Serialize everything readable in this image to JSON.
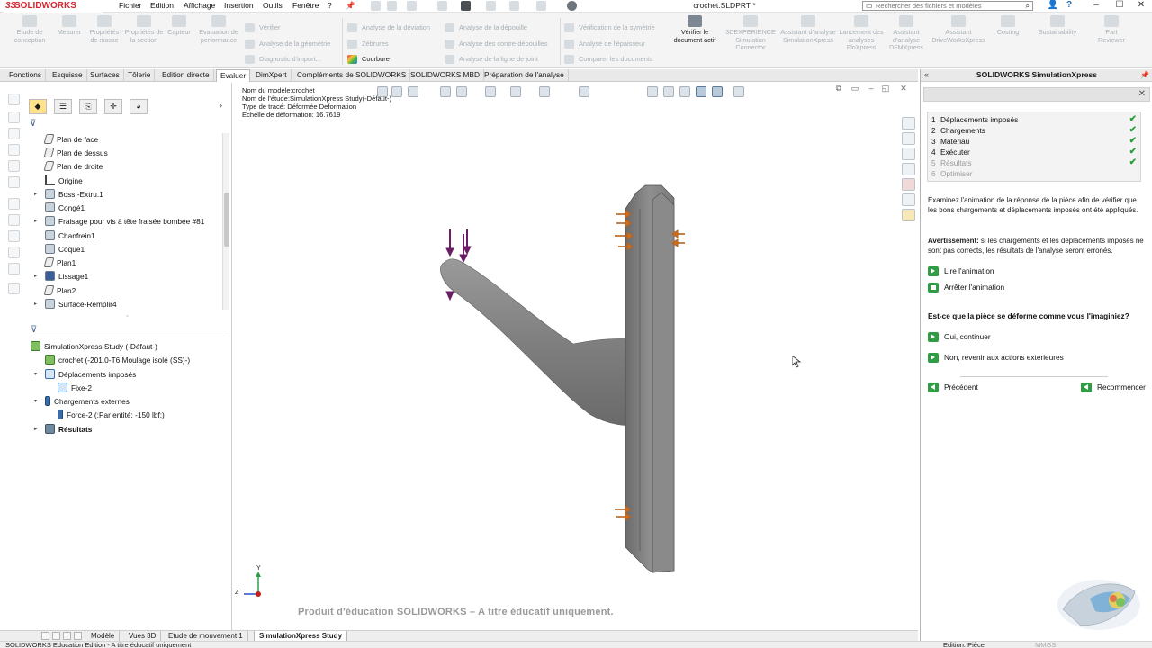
{
  "app": {
    "logo": "SOLIDWORKS",
    "logo_prefix": "3S",
    "menu": [
      "Fichier",
      "Edition",
      "Affichage",
      "Insertion",
      "Outils",
      "Fenêtre",
      "?"
    ],
    "document_title": "crochet.SLDPRT *",
    "search_placeholder": "Rechercher des fichiers et modèles",
    "help_icon_label": "?"
  },
  "ribbon": {
    "big_buttons": [
      {
        "label": "Etude de conception",
        "icon": "design-study-icon"
      },
      {
        "label": "Mesurer",
        "icon": "measure-icon"
      },
      {
        "label": "Propriétés de masse",
        "icon": "mass-properties-icon"
      },
      {
        "label": "Propriétés de la section",
        "icon": "section-properties-icon"
      },
      {
        "label": "Capteur",
        "icon": "sensor-icon"
      },
      {
        "label": "Evaluation de performance",
        "icon": "performance-icon"
      }
    ],
    "group1": [
      {
        "label": "Vérifier",
        "active": false
      },
      {
        "label": "Analyse de la géométrie",
        "active": false
      },
      {
        "label": "Diagnostic d'import...",
        "active": false
      }
    ],
    "group2": [
      {
        "label": "Analyse de la déviation",
        "active": false
      },
      {
        "label": "Zébrures",
        "active": false
      },
      {
        "label": "Courbure",
        "active": true
      }
    ],
    "group3": [
      {
        "label": "Analyse de la dépouille",
        "active": false
      },
      {
        "label": "Analyse des contre-dépouilles",
        "active": false
      },
      {
        "label": "Analyse de la ligne de joint",
        "active": false
      }
    ],
    "group4": [
      {
        "label": "Vérification de la symétrie",
        "active": false
      },
      {
        "label": "Analyse de l'épaisseur",
        "active": false
      },
      {
        "label": "Comparer les documents",
        "active": false
      }
    ],
    "verify_doc": "Vérifier le document actif",
    "right_buttons": [
      {
        "label": "3DEXPERIENCE Simulation Connector"
      },
      {
        "label": "Assistant d'analyse SimulationXpress"
      },
      {
        "label": "Lancement des analyses FloXpress"
      },
      {
        "label": "Assistant d'analyse DFMXpress"
      },
      {
        "label": "Assistant DriveWorksXpress"
      },
      {
        "label": "Costing"
      },
      {
        "label": "Sustainability"
      },
      {
        "label": "Part Reviewer"
      }
    ]
  },
  "command_tabs": [
    "Fonctions",
    "Esquisse",
    "Surfaces",
    "Tôlerie",
    "Edition directe",
    "Evaluer",
    "DimXpert",
    "Compléments de SOLIDWORKS",
    "SOLIDWORKS MBD",
    "Préparation de l'analyse"
  ],
  "active_command_tab": "Evaluer",
  "feature_tree": [
    {
      "label": "Plan de face",
      "icon": "plane-icon",
      "expandable": false
    },
    {
      "label": "Plan de dessus",
      "icon": "plane-icon",
      "expandable": false
    },
    {
      "label": "Plan de droite",
      "icon": "plane-icon",
      "expandable": false
    },
    {
      "label": "Origine",
      "icon": "origin-icon",
      "expandable": false
    },
    {
      "label": "Boss.-Extru.1",
      "icon": "boss-extrude-icon",
      "expandable": true
    },
    {
      "label": "Congé1",
      "icon": "fillet-icon",
      "expandable": false
    },
    {
      "label": "Fraisage pour vis à tête fraisée bombée #81",
      "icon": "hole-wizard-icon",
      "expandable": true
    },
    {
      "label": "Chanfrein1",
      "icon": "chamfer-icon",
      "expandable": false
    },
    {
      "label": "Coque1",
      "icon": "shell-icon",
      "expandable": false
    },
    {
      "label": "Plan1",
      "icon": "plane-icon",
      "expandable": false
    },
    {
      "label": "Lissage1",
      "icon": "loft-icon",
      "expandable": true
    },
    {
      "label": "Plan2",
      "icon": "plane-icon",
      "expandable": false
    },
    {
      "label": "Surface-Remplir4",
      "icon": "fill-surface-icon",
      "expandable": true
    }
  ],
  "study_tree": [
    {
      "label": "SimulationXpress Study (-Défaut-)",
      "icon": "study-icon",
      "level": 0,
      "expander": ""
    },
    {
      "label": "crochet (-201.0-T6 Moulage isolé (SS)-)",
      "icon": "part-material-icon",
      "level": 1,
      "expander": ""
    },
    {
      "label": "Déplacements imposés",
      "icon": "fixtures-icon",
      "level": 1,
      "expander": "▾"
    },
    {
      "label": "Fixe-2",
      "icon": "fixed-geometry-icon",
      "level": 2,
      "expander": ""
    },
    {
      "label": "Chargements externes",
      "icon": "external-loads-icon",
      "level": 1,
      "expander": "▾"
    },
    {
      "label": "Force-2 (:Par entité: -150 lbf:)",
      "icon": "force-icon",
      "level": 2,
      "expander": ""
    },
    {
      "label": "Résultats",
      "icon": "results-icon",
      "level": 1,
      "expander": "▸",
      "bold": true
    }
  ],
  "viewport": {
    "info": [
      "Nom du modèle:crochet",
      "Nom de l'étude:SimulationXpress Study(-Défaut-)",
      "Type de tracé: Déformée Deformation",
      "Echelle de déformation: 16.7619"
    ],
    "watermark": "Produit d'éducation SOLIDWORKS – A titre éducatif uniquement.",
    "triad_y": "Y",
    "triad_z": "Z"
  },
  "simxpress": {
    "title": "SOLIDWORKS SimulationXpress",
    "steps": [
      {
        "num": "1",
        "label": "Déplacements imposés",
        "done": true
      },
      {
        "num": "2",
        "label": "Chargements",
        "done": true
      },
      {
        "num": "3",
        "label": "Matériau",
        "done": true
      },
      {
        "num": "4",
        "label": "Exécuter",
        "done": true
      },
      {
        "num": "5",
        "label": "Résultats",
        "done": true
      },
      {
        "num": "6",
        "label": "Optimiser",
        "done": false
      }
    ],
    "description": "Examinez l'animation de la réponse de la pièce afin de vérifier que les bons chargements et déplacements imposés ont été appliqués.",
    "warning_label": "Avertissement:",
    "warning_text": " si les chargements et les déplacements imposés ne sont pas corrects, les résultats de l'analyse seront erronés.",
    "play_label": "Lire l'animation",
    "stop_label": "Arrêter l'animation",
    "question": "Est-ce que la pièce se déforme comme vous l'imaginiez?",
    "yes_label": "Oui, continuer",
    "no_label": "Non, revenir aux actions extérieures",
    "prev_label": "Précédent",
    "restart_label": "Recommencer"
  },
  "bottom_tabs": [
    "Modèle",
    "Vues 3D",
    "Etude de mouvement 1",
    "SimulationXpress Study"
  ],
  "active_bottom_tab": "SimulationXpress Study",
  "status": {
    "left": "SOLIDWORKS Education Edition - A titre éducatif uniquement",
    "edit": "Edition: Pièce",
    "units": "MMGS"
  },
  "colors": {
    "brand": "#d22630",
    "success": "#2a9d3a",
    "load_arrow": "#7a1f6e",
    "fixture": "#c06a1a",
    "part_gray": "#8c8c8c"
  }
}
